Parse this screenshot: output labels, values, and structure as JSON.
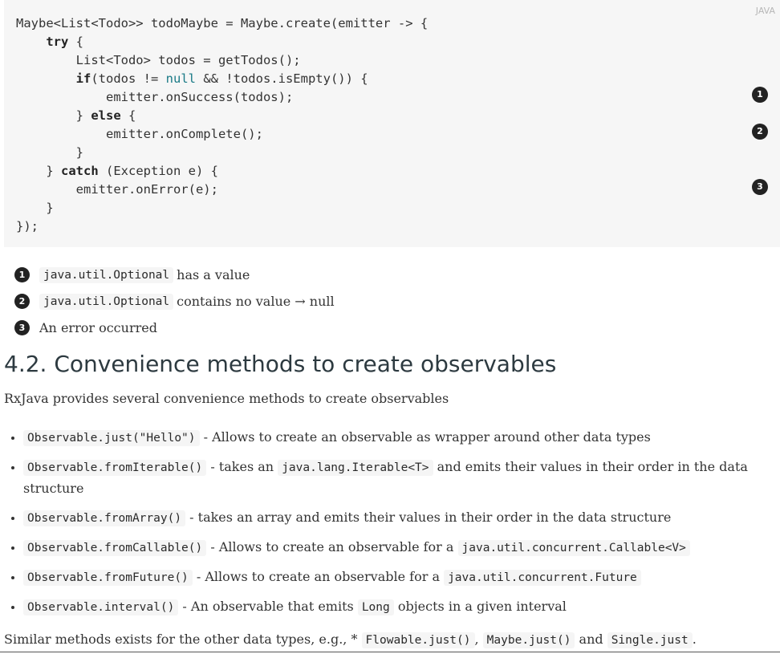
{
  "code_block": {
    "language": "JAVA",
    "lines": {
      "l1": "Maybe<List<Todo>> todoMaybe = Maybe.create(emitter -> {",
      "l2_kw": "try",
      "l2_rest": " {",
      "l3": "List<Todo> todos = getTodos();",
      "l4_kw": "if",
      "l4_a": "(todos != ",
      "l4_lit": "null",
      "l4_b": " && !todos.isEmpty()) {",
      "l5": "emitter.onSuccess(todos);",
      "l6_a": "} ",
      "l6_kw": "else",
      "l6_b": " {",
      "l7": "emitter.onComplete();",
      "l8": "}",
      "l9_a": "} ",
      "l9_kw": "catch",
      "l9_b": " (Exception e) {",
      "l10": "emitter.onError(e);",
      "l11": "}",
      "l12": "});"
    },
    "callouts": [
      "1",
      "2",
      "3"
    ]
  },
  "callout_list": [
    {
      "num": "1",
      "code": "java.util.Optional",
      "text": "has a value"
    },
    {
      "num": "2",
      "code": "java.util.Optional",
      "text": "contains no value → null"
    },
    {
      "num": "3",
      "text": "An error occurred"
    }
  ],
  "section": {
    "heading": "4.2. Convenience methods to create observables",
    "intro": "RxJava provides several convenience methods to create observables"
  },
  "methods": [
    {
      "code": "Observable.just(\"Hello\")",
      "text": " - Allows to create an observable as wrapper around other data types"
    },
    {
      "code": "Observable.fromIterable()",
      "text_a": " - takes an ",
      "code2": "java.lang.Iterable<T>",
      "text_b": " and emits their values in their order in the data structure"
    },
    {
      "code": "Observable.fromArray()",
      "text": " - takes an array and emits their values in their order in the data structure"
    },
    {
      "code": "Observable.fromCallable()",
      "text": " - Allows to create an observable for a ",
      "code2": "java.util.concurrent.Callable<V>"
    },
    {
      "code": "Observable.fromFuture()",
      "text": " - Allows to create an observable for a ",
      "code2": "java.util.concurrent.Future"
    },
    {
      "code": "Observable.interval()",
      "text_a": " - An observable that emits ",
      "code2": "Long",
      "text_b": " objects in a given interval"
    }
  ],
  "outro": {
    "text_a": "Similar methods exists for the other data types, e.g., * ",
    "code1": "Flowable.just()",
    "sep1": ", ",
    "code2": "Maybe.just()",
    "sep2": " and ",
    "code3": "Single.just",
    "end": "."
  }
}
